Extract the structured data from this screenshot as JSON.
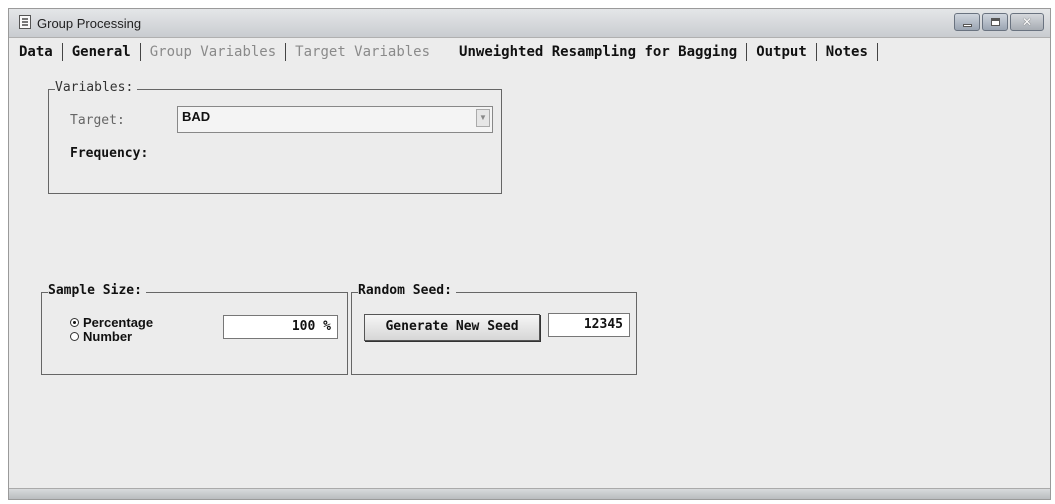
{
  "window": {
    "title": "Group Processing"
  },
  "tabs": [
    {
      "label": "Data",
      "state": "enabled"
    },
    {
      "label": "General",
      "state": "enabled"
    },
    {
      "label": "Group Variables",
      "state": "disabled"
    },
    {
      "label": "Target Variables",
      "state": "disabled"
    },
    {
      "label": "Unweighted Resampling for Bagging",
      "state": "selected"
    },
    {
      "label": "Output",
      "state": "enabled"
    },
    {
      "label": "Notes",
      "state": "enabled"
    }
  ],
  "variables": {
    "title": "Variables:",
    "target_label": "Target:",
    "target_value": "BAD",
    "frequency_label": "Frequency:"
  },
  "sample_size": {
    "title": "Sample Size:",
    "options": [
      {
        "label": "Percentage",
        "checked": true
      },
      {
        "label": "Number",
        "checked": false
      }
    ],
    "value": "100 %"
  },
  "random_seed": {
    "title": "Random Seed:",
    "button_label": "Generate New Seed",
    "value": "12345"
  }
}
